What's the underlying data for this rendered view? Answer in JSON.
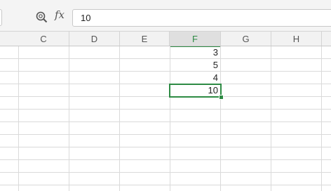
{
  "formula_bar": {
    "fx_label": "fx",
    "value": "10",
    "icons": {
      "zoom": "magnifier-icon"
    }
  },
  "columns": [
    {
      "label": "C"
    },
    {
      "label": "D"
    },
    {
      "label": "E"
    },
    {
      "label": "F",
      "active": true
    },
    {
      "label": "G"
    },
    {
      "label": "H"
    }
  ],
  "cells": {
    "F1": "3",
    "F2": "5",
    "F3": "4",
    "F4": "10"
  },
  "colors": {
    "accent": "#2e8b44",
    "header_bg": "#f2f2f2",
    "grid_line": "#dadada"
  }
}
